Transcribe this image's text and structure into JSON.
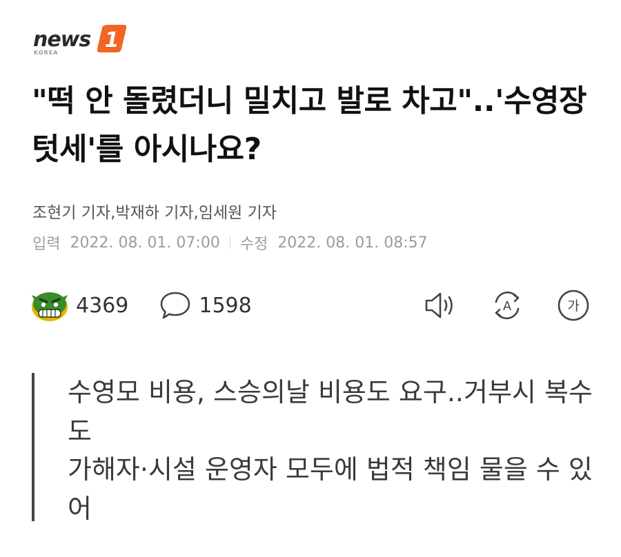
{
  "brand": {
    "name": "news",
    "badge": "1",
    "sub": "KOREA",
    "accent": "#f26522"
  },
  "article": {
    "headline": "\"떡 안 돌렸더니 밀치고 발로 차고\"..'수영장 텃세'를 아시나요?",
    "reporters": "조현기 기자,박재하 기자,임세원 기자",
    "published_label": "입력",
    "published": "2022. 08. 01. 07:00",
    "modified_label": "수정",
    "modified": "2022. 08. 01. 08:57"
  },
  "stats": {
    "reactions": "4369",
    "comments": "1598",
    "reaction_icon": "angry-face-icon",
    "comment_icon": "speech-bubble-icon"
  },
  "tools": {
    "listen_icon": "speaker-icon",
    "translate_icon": "translate-icon",
    "translate_glyph": "A",
    "font_icon": "font-size-icon",
    "font_glyph": "가"
  },
  "summary": {
    "lines": [
      "수영모 비용, 스승의날 비용도 요구..거부시 복수도",
      "가해자·시설 운영자 모두에 법적 책임 물을 수 있어"
    ]
  }
}
